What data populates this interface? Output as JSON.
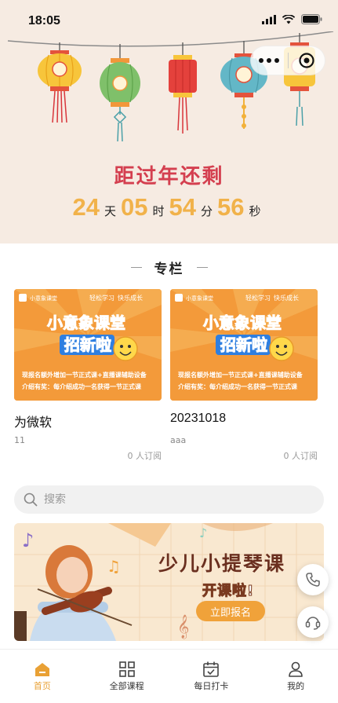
{
  "status_bar": {
    "time": "18:05"
  },
  "countdown": {
    "title": "距过年还剩",
    "days": "24",
    "days_unit": "天",
    "hours": "05",
    "hours_unit": "时",
    "minutes": "54",
    "minutes_unit": "分",
    "seconds": "56",
    "seconds_unit": "秒"
  },
  "section": {
    "title": "专栏"
  },
  "cards": [
    {
      "name": "为微软",
      "desc": "11",
      "subs": "0 人订阅"
    },
    {
      "name": "20231018",
      "desc": "aaa",
      "subs": "0 人订阅"
    }
  ],
  "poster": {
    "brand": "小意象课堂",
    "slogan_a": "轻松学习",
    "slogan_b": "快乐成长",
    "headline": "小意象课堂",
    "headline2": "招新啦",
    "line1": "现报名额外增加一节正式课+直播课辅助设备",
    "line2": "介绍有奖：每介绍成功一名获得一节正式课"
  },
  "search": {
    "placeholder": "搜索"
  },
  "banner": {
    "title": "少儿小提琴课",
    "subtitle": "开课啦!",
    "button": "立即报名"
  },
  "tabbar": {
    "items": [
      {
        "label": "首页",
        "icon": "home-icon",
        "active": true
      },
      {
        "label": "全部课程",
        "icon": "grid-icon",
        "active": false
      },
      {
        "label": "每日打卡",
        "icon": "calendar-check-icon",
        "active": false
      },
      {
        "label": "我的",
        "icon": "user-icon",
        "active": false
      }
    ]
  },
  "colors": {
    "accent": "#e9a135",
    "countdown_title": "#d43f4f",
    "countdown_number": "#f1b24a",
    "hero_bg": "#f6ebe2"
  }
}
